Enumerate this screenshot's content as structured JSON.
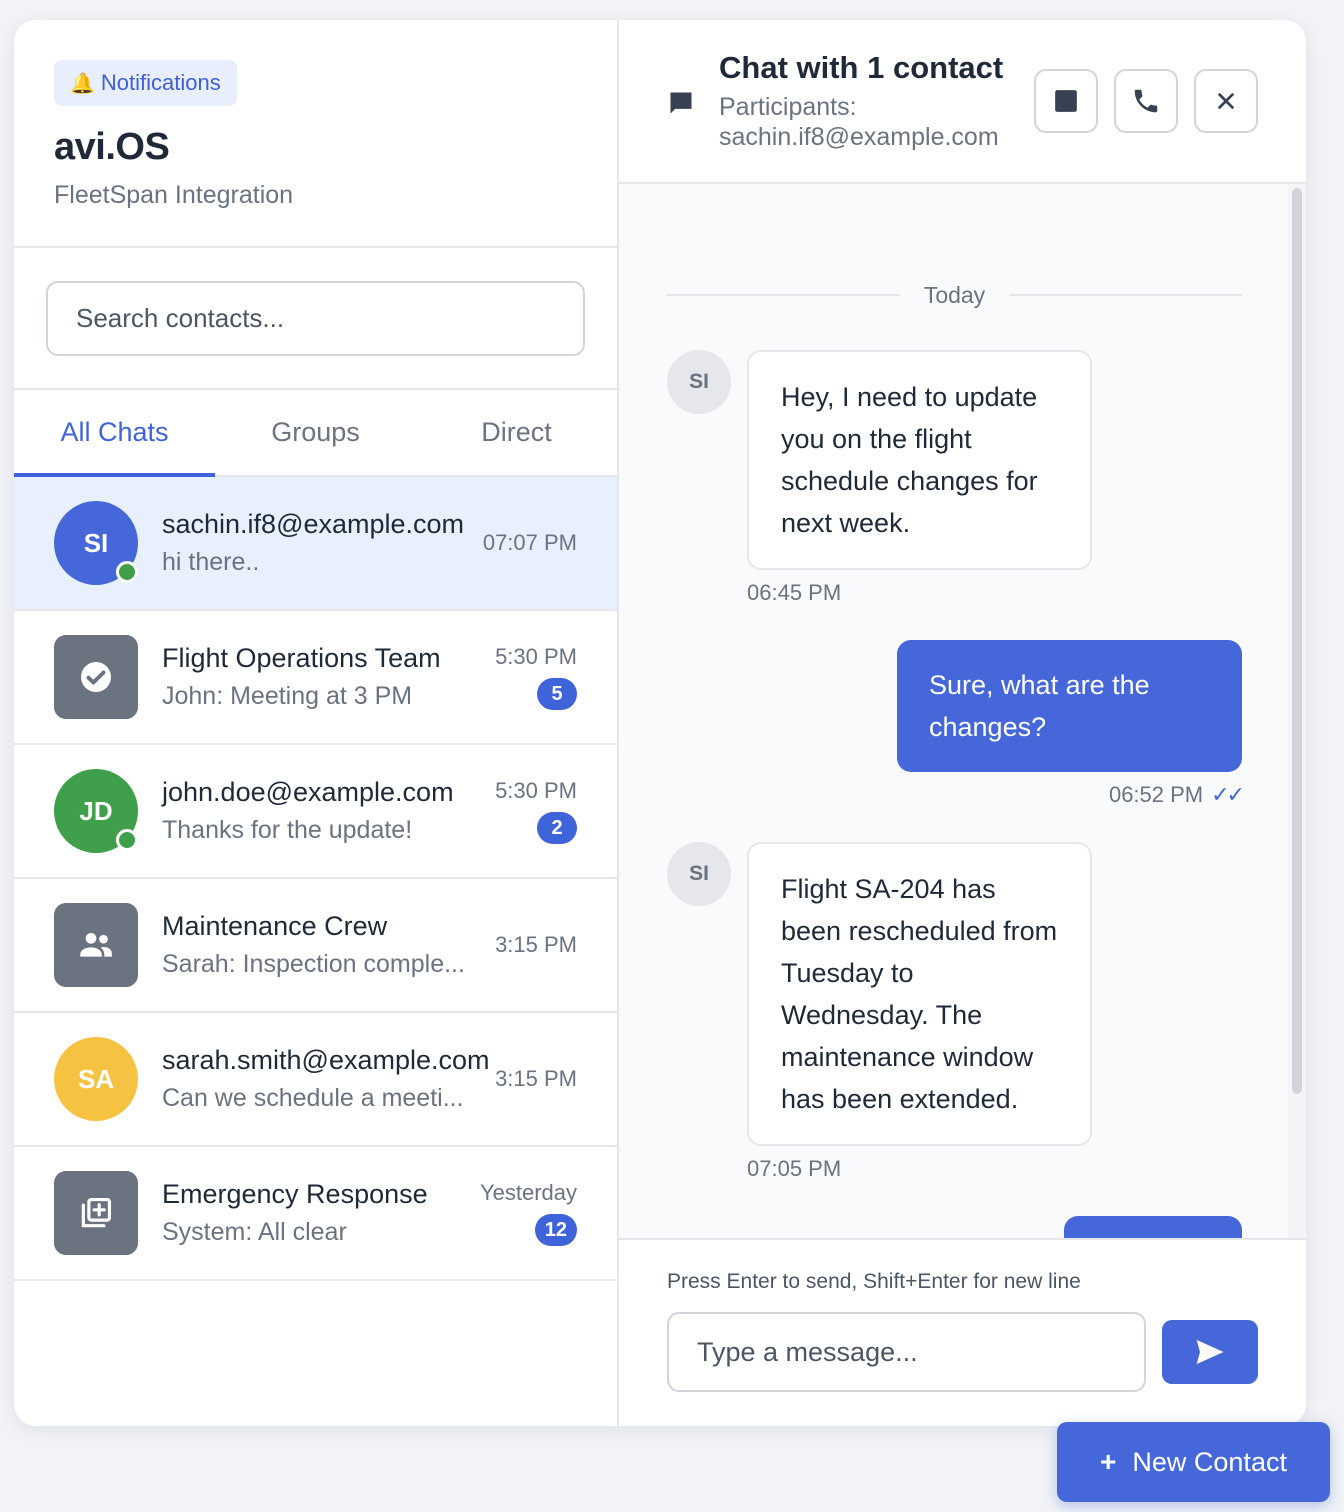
{
  "brand": {
    "notification_label": "Notifications",
    "title": "avi.OS",
    "subtitle": "FleetSpan Integration"
  },
  "search": {
    "placeholder": "Search contacts..."
  },
  "tabs": [
    {
      "label": "All Chats",
      "active": true
    },
    {
      "label": "Groups",
      "active": false
    },
    {
      "label": "Direct",
      "active": false
    }
  ],
  "chats": [
    {
      "name": "sachin.if8@example.com",
      "preview": "hi there..",
      "time": "07:07 PM",
      "avatar": "SI",
      "avatar_color": "#4567d9",
      "online": true,
      "unread": "",
      "active": true
    },
    {
      "name": "Flight Operations Team",
      "preview": "John: Meeting at 3 PM",
      "time": "5:30 PM",
      "avatar_icon": "check-circle-icon",
      "unread": "5"
    },
    {
      "name": "john.doe@example.com",
      "preview": "Thanks for the update!",
      "time": "5:30 PM",
      "avatar": "JD",
      "avatar_color": "#3f9f4a",
      "online": true,
      "unread": "2"
    },
    {
      "name": "Maintenance Crew",
      "preview": "Sarah: Inspection comple...",
      "time": "3:15 PM",
      "avatar_icon": "group-icon",
      "unread": ""
    },
    {
      "name": "sarah.smith@example.com",
      "preview": "Can we schedule a meeti...",
      "time": "3:15 PM",
      "avatar": "SA",
      "avatar_color": "#f5c242",
      "online": false,
      "unread": ""
    },
    {
      "name": "Emergency Response",
      "preview": "System: All clear",
      "time": "Yesterday",
      "avatar_icon": "add-box-icon",
      "unread": "12"
    }
  ],
  "header": {
    "title": "Chat with 1 contact",
    "participants_label": "Participants:",
    "participants": "sachin.if8@example.com"
  },
  "messages": {
    "day_label": "Today",
    "items": [
      {
        "direction": "in",
        "avatar": "SI",
        "text": "Hey, I need to update you on the flight schedule changes for next week.",
        "time": "06:45 PM"
      },
      {
        "direction": "out",
        "text": "Sure, what are the changes?",
        "time": "06:52 PM",
        "status": "✓✓"
      },
      {
        "direction": "in",
        "avatar": "SI",
        "text": "Flight SA-204 has been rescheduled from Tuesday to Wednesday. The maintenance window has been extended.",
        "time": "07:05 PM"
      }
    ]
  },
  "composer": {
    "hint": "Press Enter to send, Shift+Enter for new line",
    "placeholder": "Type a message..."
  },
  "new_contact_label": "New Contact",
  "colors": {
    "accent": "#4567d9",
    "online": "#3f9f4a",
    "active_row": "#e8effd"
  }
}
